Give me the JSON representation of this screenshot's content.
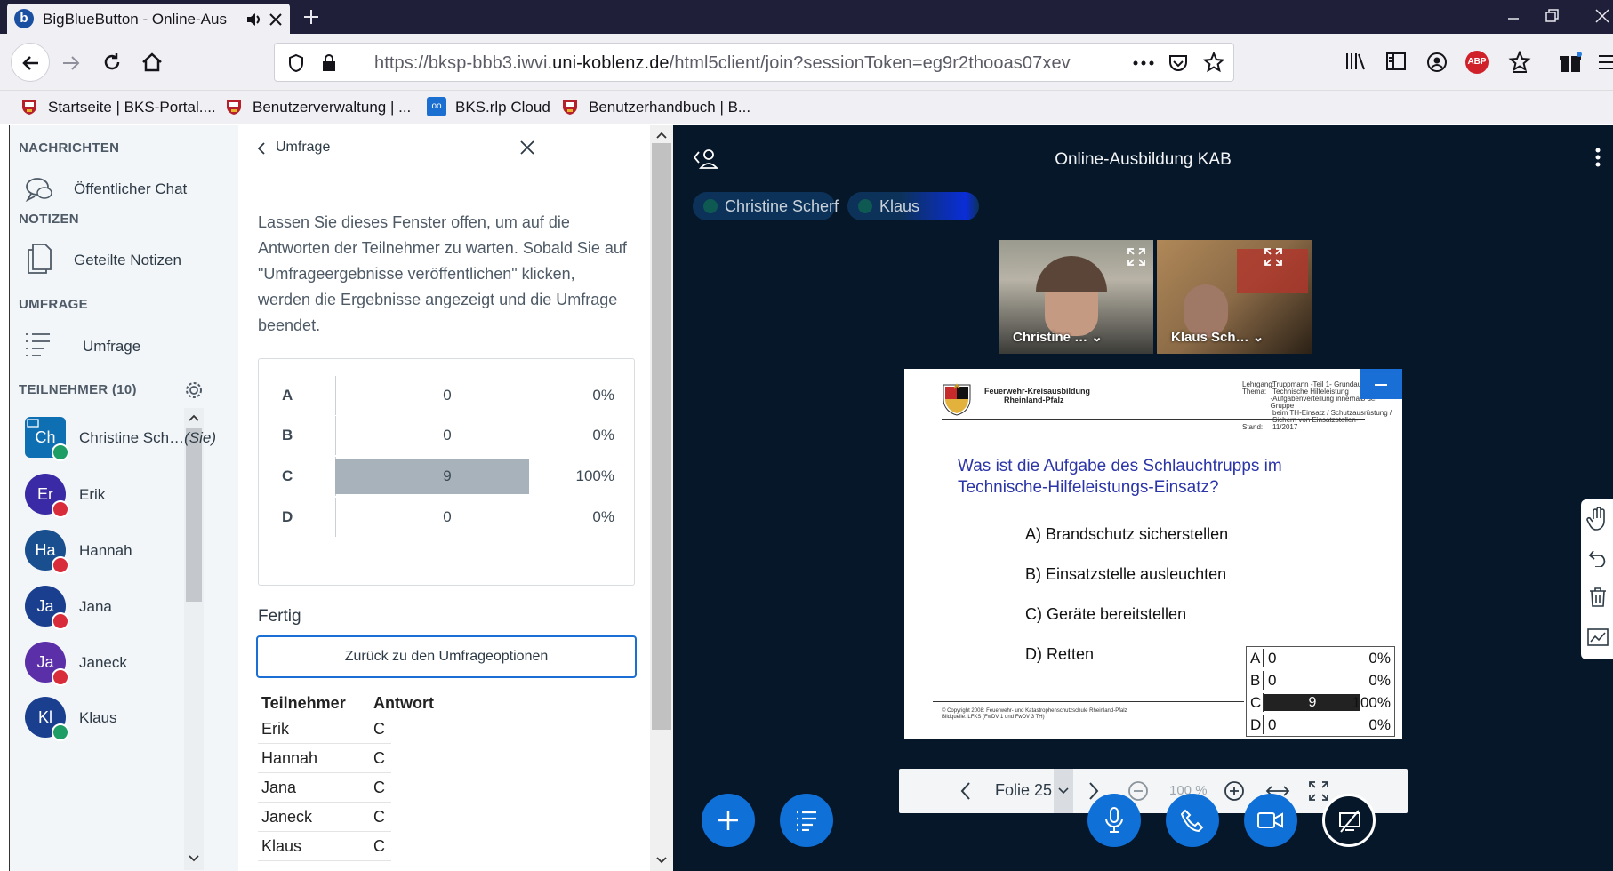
{
  "browser": {
    "tab_title": "BigBlueButton - Online-Aus",
    "url_prefix": "https://bksp-bbb3.iwvi.",
    "url_domain": "uni-koblenz.de",
    "url_suffix": "/html5client/join?sessionToken=eg9r2thooas07xev",
    "bookmarks": [
      {
        "label": "Startseite | BKS-Portal...."
      },
      {
        "label": "Benutzerverwaltung | ..."
      },
      {
        "label": "BKS.rlp Cloud"
      },
      {
        "label": "Benutzerhandbuch | B..."
      }
    ],
    "abp_label": "ABP"
  },
  "sidebar": {
    "messages_title": "NACHRICHTEN",
    "public_chat": "Öffentlicher Chat",
    "notes_title": "NOTIZEN",
    "shared_notes": "Geteilte Notizen",
    "poll_title": "UMFRAGE",
    "poll_item": "Umfrage",
    "participants_title": "TEILNEHMER (10)",
    "users": [
      {
        "initials": "Ch",
        "name": "Christine Sch…",
        "suffix": "(Sie)",
        "color": "#0e6fb3"
      },
      {
        "initials": "Er",
        "name": "Erik",
        "suffix": "",
        "color": "#3a2aa5"
      },
      {
        "initials": "Ha",
        "name": "Hannah",
        "suffix": "",
        "color": "#1a4f8f"
      },
      {
        "initials": "Ja",
        "name": "Jana",
        "suffix": "",
        "color": "#1a3f8f"
      },
      {
        "initials": "Ja",
        "name": "Janeck",
        "suffix": "",
        "color": "#5a2fa8"
      },
      {
        "initials": "Kl",
        "name": "Klaus",
        "suffix": "",
        "color": "#1a3f8f"
      }
    ]
  },
  "poll_panel": {
    "back_label": "Umfrage",
    "description": "Lassen Sie dieses Fenster offen, um auf die Antworten der Teilnehmer zu warten. Sobald Sie auf \"Umfrageergebnisse veröffentlichen\" klicken, werden die Ergebnisse angezeigt und die Umfrage beendet.",
    "results": [
      {
        "key": "A",
        "count": "0",
        "percent": "0%",
        "fraction": 0
      },
      {
        "key": "B",
        "count": "0",
        "percent": "0%",
        "fraction": 0
      },
      {
        "key": "C",
        "count": "9",
        "percent": "100%",
        "fraction": 1
      },
      {
        "key": "D",
        "count": "0",
        "percent": "0%",
        "fraction": 0
      }
    ],
    "done_label": "Fertig",
    "back_button": "Zurück zu den Umfrageoptionen",
    "table_headers": {
      "participant": "Teilnehmer",
      "answer": "Antwort"
    },
    "answers": [
      {
        "name": "Erik",
        "answer": "C"
      },
      {
        "name": "Hannah",
        "answer": "C"
      },
      {
        "name": "Jana",
        "answer": "C"
      },
      {
        "name": "Janeck",
        "answer": "C"
      },
      {
        "name": "Klaus",
        "answer": "C"
      }
    ]
  },
  "main": {
    "title": "Online-Ausbildung KAB",
    "talkers": [
      "Christine Scherf",
      "Klaus"
    ],
    "videos": [
      {
        "name": "Christine …"
      },
      {
        "name": "Klaus Sch…"
      }
    ],
    "slide": {
      "org_line1": "Feuerwehr-Kreisausbildung",
      "org_line2": "Rheinland-Pfalz",
      "meta_labels": [
        "Lehrgang:",
        "Thema:",
        "",
        "",
        "",
        "Stand:"
      ],
      "meta_values": [
        "Truppmann -Teil 1- Grundausbildung",
        "Technische Hilfeleistung",
        "-Aufgabenverteilung innerhalb der Gruppe",
        "beim TH-Einsatz / Schutzausrüstung /",
        "Sichern von Einsatzstellen-",
        "11/2017"
      ],
      "question": "Was ist die Aufgabe des Schlauchtrupps im Technische-Hilfeleistungs-Einsatz?",
      "options": [
        "A)  Brandschutz sicherstellen",
        "B)  Einsatzstelle ausleuchten",
        "C) Geräte bereitstellen",
        "D) Retten"
      ],
      "footer1": "© Copyright 2008: Feuerwehr- und Katastrophenschutzschule Rheinland-Pfalz",
      "footer2": "Bildquelle: LFKS (FwDV 1 und FwDV 3 TH)",
      "results": [
        {
          "key": "A",
          "count": "0",
          "percent": "0%"
        },
        {
          "key": "B",
          "count": "0",
          "percent": "0%"
        },
        {
          "key": "C",
          "count": "9",
          "percent": "100%"
        },
        {
          "key": "D",
          "count": "0",
          "percent": "0%"
        }
      ]
    },
    "toolbar": {
      "slide_label": "Folie 25",
      "zoom": "100 %"
    }
  }
}
